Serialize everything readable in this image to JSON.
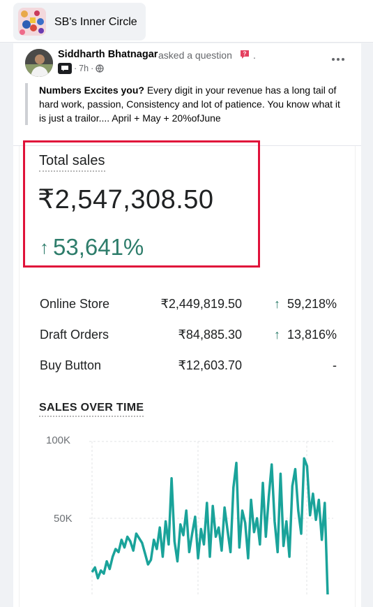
{
  "group": {
    "name": "SB's Inner Circle",
    "avatar_icon": "group-collage-icon"
  },
  "post": {
    "author": "Siddharth Bhatnagar",
    "action": "asked a question",
    "action_suffix": ".",
    "time": "7h",
    "time_sep": "·",
    "privacy_icon": "globe-icon",
    "bold_lead": "Numbers Excites you?",
    "body": " Every digit in your revenue has a long tail of hard work, passion, Consistency and lot of patience. You know what it is just a trailor.... April + May + 20%ofJune"
  },
  "report": {
    "total_sales_label": "Total sales",
    "total_sales_value": "₹2,547,308.50",
    "total_change_arrow": "↑",
    "total_change": "53,641%",
    "rows": [
      {
        "name": "Online Store",
        "value": "₹2,449,819.50",
        "arrow": "↑",
        "change": "59,218%"
      },
      {
        "name": "Draft Orders",
        "value": "₹84,885.30",
        "arrow": "↑",
        "change": "13,816%"
      },
      {
        "name": "Buy Button",
        "value": "₹12,603.70",
        "arrow": "",
        "change": "-"
      }
    ],
    "sales_over_time_label": "SALES OVER TIME",
    "accent_color": "#2e7d6b",
    "highlight_color": "#e0123a"
  },
  "chart_data": {
    "type": "line",
    "title": "SALES OVER TIME",
    "y_ticks": [
      "100K",
      "50K"
    ],
    "ylim": [
      0,
      100000
    ],
    "grid": true,
    "series": [
      {
        "color": "#1aa39a",
        "values": [
          15000,
          18000,
          11000,
          16000,
          14000,
          22000,
          17000,
          25000,
          30000,
          28000,
          36000,
          31000,
          38000,
          35000,
          29000,
          40000,
          37000,
          34000,
          27000,
          20000,
          23000,
          36000,
          30000,
          44000,
          25000,
          48000,
          33000,
          76000,
          35000,
          22000,
          46000,
          39000,
          55000,
          28000,
          40000,
          51000,
          24000,
          43000,
          33000,
          60000,
          25000,
          58000,
          38000,
          44000,
          29000,
          57000,
          42000,
          28000,
          70000,
          86000,
          31000,
          55000,
          47000,
          24000,
          62000,
          41000,
          50000,
          33000,
          73000,
          38000,
          64000,
          85000,
          48000,
          28000,
          79000,
          32000,
          48000,
          25000,
          71000,
          82000,
          55000,
          40000,
          89000,
          84000,
          52000,
          66000,
          49000,
          62000,
          36000,
          60000,
          0
        ]
      }
    ]
  }
}
